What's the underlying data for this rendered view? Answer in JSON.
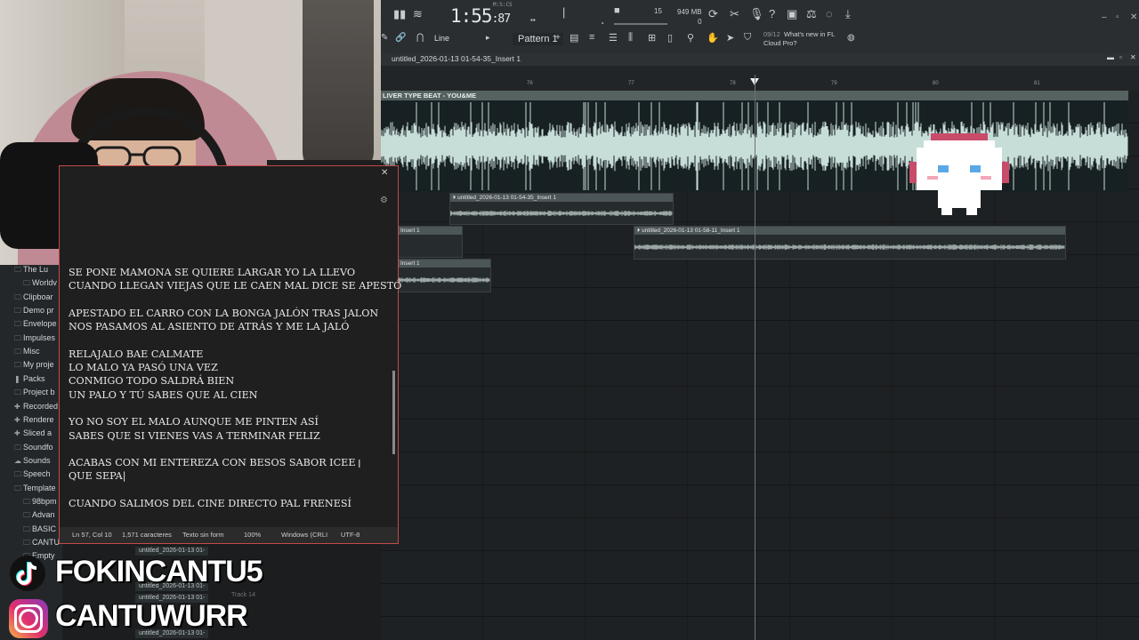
{
  "toolbar": {
    "clock_main": "1:55",
    "clock_sub": "87",
    "clock_unit": "M:S:CS",
    "cpu_value": "15",
    "memory": "949 MB",
    "memory_sub": "0",
    "snap_mode": "Line",
    "pattern": "Pattern 1",
    "news_count": "09/12",
    "news_text_1": "What's new in FL",
    "news_text_2": "Cloud Pro?"
  },
  "playlist": {
    "title": "untitled_2026-01-13 01-54-35_Insert 1",
    "main_clip_label": "LIVER TYPE BEAT - YOU&ME",
    "ruler_ticks": [
      "76",
      "77",
      "78",
      "79",
      "80",
      "81"
    ],
    "clips": [
      {
        "label": "untitled_2026-01-13 01-54-35_Insert 1"
      },
      {
        "label": "Insert 1"
      },
      {
        "label": "untitled_2026-01-13 01-58-11_Insert 1"
      },
      {
        "label": "Insert 1"
      }
    ]
  },
  "browser": {
    "items": [
      {
        "label": "The Lu",
        "icon": "folder-icon"
      },
      {
        "label": "Worldv",
        "icon": "folder-icon"
      },
      {
        "label": "Clipboar",
        "icon": "folder-icon"
      },
      {
        "label": "Demo pr",
        "icon": "folder-icon"
      },
      {
        "label": "Envelope",
        "icon": "folder-icon"
      },
      {
        "label": "Impulses",
        "icon": "folder-icon"
      },
      {
        "label": "Misc",
        "icon": "folder-icon"
      },
      {
        "label": "My proje",
        "icon": "folder-icon"
      },
      {
        "label": "Packs",
        "icon": "packs-icon"
      },
      {
        "label": "Project b",
        "icon": "folder-icon"
      },
      {
        "label": "Recorded",
        "icon": "plus-icon"
      },
      {
        "label": "Rendere",
        "icon": "plus-icon"
      },
      {
        "label": "Sliced a",
        "icon": "plus-icon"
      },
      {
        "label": "Soundfo",
        "icon": "folder-icon"
      },
      {
        "label": "Sounds",
        "icon": "cloud-icon"
      },
      {
        "label": "Speech",
        "icon": "folder-icon"
      },
      {
        "label": "Template",
        "icon": "folder-icon"
      },
      {
        "label": "98bpm",
        "icon": "folder-icon"
      },
      {
        "label": "Advan",
        "icon": "folder-icon"
      },
      {
        "label": "BASIC",
        "icon": "folder-icon"
      },
      {
        "label": "CANTU",
        "icon": "folder-icon"
      },
      {
        "label": "Empty",
        "icon": "folder-icon"
      }
    ]
  },
  "notepad": {
    "lines": "SE PONE MAMONA SE QUIERE LARGAR YO LA LLEVO\nCUANDO LLEGAN VIEJAS QUE LE CAEN MAL DICE SE APESTÓ\n\nAPESTADO EL CARRO CON LA BONGA JALÓN TRAS JALON\nNOS PASAMOS AL ASIENTO DE ATRÁS Y ME LA JALÓ\n\nRELAJALO BAE CALMATE\nLO MALO YA PASÓ UNA VEZ\nCONMIGO TODO SALDRÁ BIEN\nUN PALO Y TÚ SABES QUE AL CIEN\n\nYO NO SOY EL MALO AUNQUE ME PINTEN ASÍ\nSABES QUE SI VIENES VAS A TERMINAR FELIZ\n\nACABAS CON MI ENTEREZA CON BESOS SABOR ICEE\nQUE SEPA|\n\nCUANDO SALIMOS DEL CINE DIRECTO PAL FRENESÍ",
    "status_position": "Ln 57, Col 10",
    "status_chars": "1,571 caracteres",
    "status_format": "Texto sin form",
    "status_zoom": "100%",
    "status_eol": "Windows (CRLI",
    "status_encoding": "UTF-8"
  },
  "social": {
    "tiktok_handle": "FOKINCANTU5",
    "instagram_handle": "CANTUWURR"
  },
  "bottom_clips": [
    "untitled_2026-01-13 01-",
    "untitled_2026-01-13 01-",
    "untitled_2026-01-13 01-",
    "untitled_2026-01-13 01-"
  ],
  "bottom_misc": {
    "track_label": "Track 14"
  },
  "colors": {
    "waveform": "#c7ddd8",
    "clip_header": "#55625f",
    "notepad_border": "#c24a4a"
  }
}
